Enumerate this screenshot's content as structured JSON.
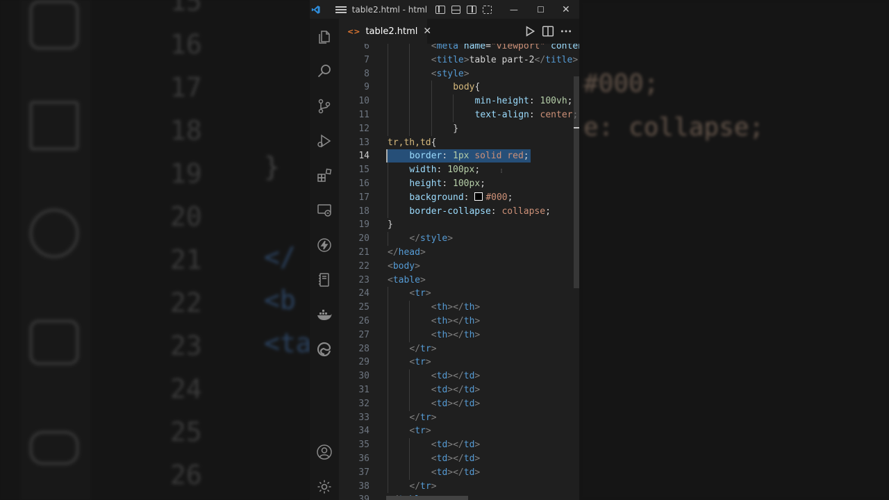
{
  "window": {
    "title": "table2.html - html ...",
    "controls": {
      "minimize": "—",
      "maximize": "☐",
      "close": "✕"
    }
  },
  "tab": {
    "icon": "<>",
    "label": "table2.html",
    "close": "✕"
  },
  "activity_icons": [
    "explorer-icon",
    "search-icon",
    "source-control-icon",
    "run-debug-icon",
    "extensions-icon",
    "remote-explorer-icon",
    "lightning-icon",
    "notebook-icon",
    "docker-icon",
    "edge-icon",
    "account-icon",
    "settings-gear-icon"
  ],
  "editor": {
    "current_line": 14,
    "lines": [
      {
        "n": "6",
        "code": "<meta name=\"viewport\" content="
      },
      {
        "n": "7",
        "code": "<title>table part-2</title>"
      },
      {
        "n": "8",
        "code": "<style>"
      },
      {
        "n": "9",
        "code": "body{"
      },
      {
        "n": "10",
        "code": "min-height: 100vh;"
      },
      {
        "n": "11",
        "code": "text-align: center;"
      },
      {
        "n": "12",
        "code": "}"
      },
      {
        "n": "13",
        "code": "tr,th,td{"
      },
      {
        "n": "14",
        "code": "border: 1px solid red;"
      },
      {
        "n": "15",
        "code": "width: 100px;"
      },
      {
        "n": "16",
        "code": "height: 100px;"
      },
      {
        "n": "17",
        "code": "background: #000;"
      },
      {
        "n": "18",
        "code": "border-collapse: collapse;"
      },
      {
        "n": "19",
        "code": "}"
      },
      {
        "n": "20",
        "code": "</style>"
      },
      {
        "n": "21",
        "code": "</head>"
      },
      {
        "n": "22",
        "code": "<body>"
      },
      {
        "n": "23",
        "code": "<table>"
      },
      {
        "n": "24",
        "code": "<tr>"
      },
      {
        "n": "25",
        "code": "<th></th>"
      },
      {
        "n": "26",
        "code": "<th></th>"
      },
      {
        "n": "27",
        "code": "<th></th>"
      },
      {
        "n": "28",
        "code": "</tr>"
      },
      {
        "n": "29",
        "code": "<tr>"
      },
      {
        "n": "30",
        "code": "<td></td>"
      },
      {
        "n": "31",
        "code": "<td></td>"
      },
      {
        "n": "32",
        "code": "<td></td>"
      },
      {
        "n": "33",
        "code": "</tr>"
      },
      {
        "n": "34",
        "code": "<tr>"
      },
      {
        "n": "35",
        "code": "<td></td>"
      },
      {
        "n": "36",
        "code": "<td></td>"
      },
      {
        "n": "37",
        "code": "<td></td>"
      },
      {
        "n": "38",
        "code": "</tr>"
      },
      {
        "n": "39",
        "code": "</table>"
      }
    ]
  },
  "background": {
    "left_line_numbers": [
      "15",
      "16",
      "17",
      "18",
      "19",
      "20",
      "21",
      "22",
      "23",
      "24",
      "25",
      "26"
    ],
    "left_fragments": [
      "}",
      "</",
      "<b",
      "<ta"
    ],
    "right_fragments": [
      "#000;",
      "e: collapse;"
    ]
  },
  "colors": {
    "accent": "#569cd6",
    "selection": "#264f78",
    "editor_bg": "#1f1f1f"
  }
}
